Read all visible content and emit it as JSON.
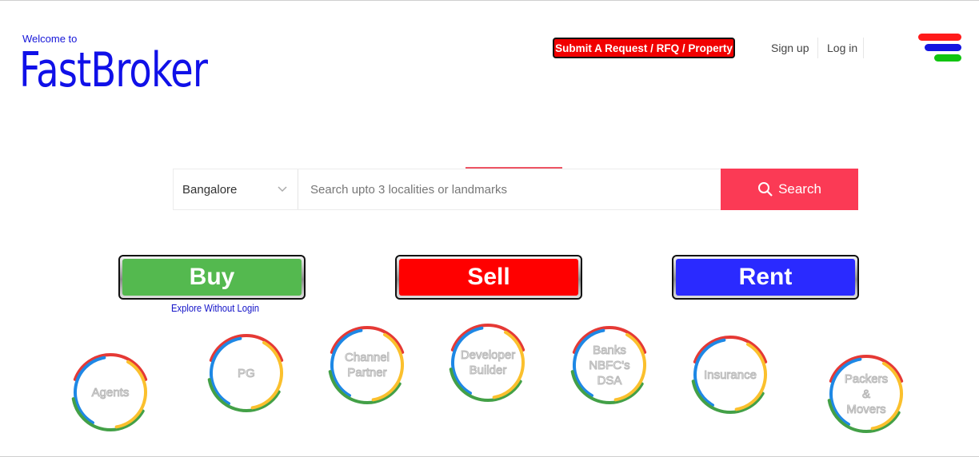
{
  "header": {
    "welcome": "Welcome to",
    "brand": "FastBroker",
    "submit_button": "Submit A Request / RFQ / Property",
    "signup": "Sign up",
    "login": "Log in",
    "menu_colors": [
      "#ff1a1a",
      "#1414e0",
      "#11c411"
    ]
  },
  "search": {
    "city": "Bangalore",
    "placeholder": "Search upto 3 localities or landmarks",
    "button_label": "Search",
    "accent": "#fb3a55"
  },
  "actions": {
    "buy": "Buy",
    "sell": "Sell",
    "rent": "Rent",
    "colors": {
      "buy": "#54b94f",
      "sell": "#ff0000",
      "rent": "#2a2aff"
    },
    "explore": "Explore Without Login"
  },
  "categories": [
    {
      "label": "Agents"
    },
    {
      "label": "PG"
    },
    {
      "label": "Channel\nPartner"
    },
    {
      "label": "Developer\nBuilder"
    },
    {
      "label": "Banks\nNBFC's\nDSA"
    },
    {
      "label": "Insurance"
    },
    {
      "label": "Packers\n&\nMovers"
    }
  ],
  "ring_colors": [
    "#e53935",
    "#1e88e5",
    "#43a047",
    "#fbc02d"
  ]
}
